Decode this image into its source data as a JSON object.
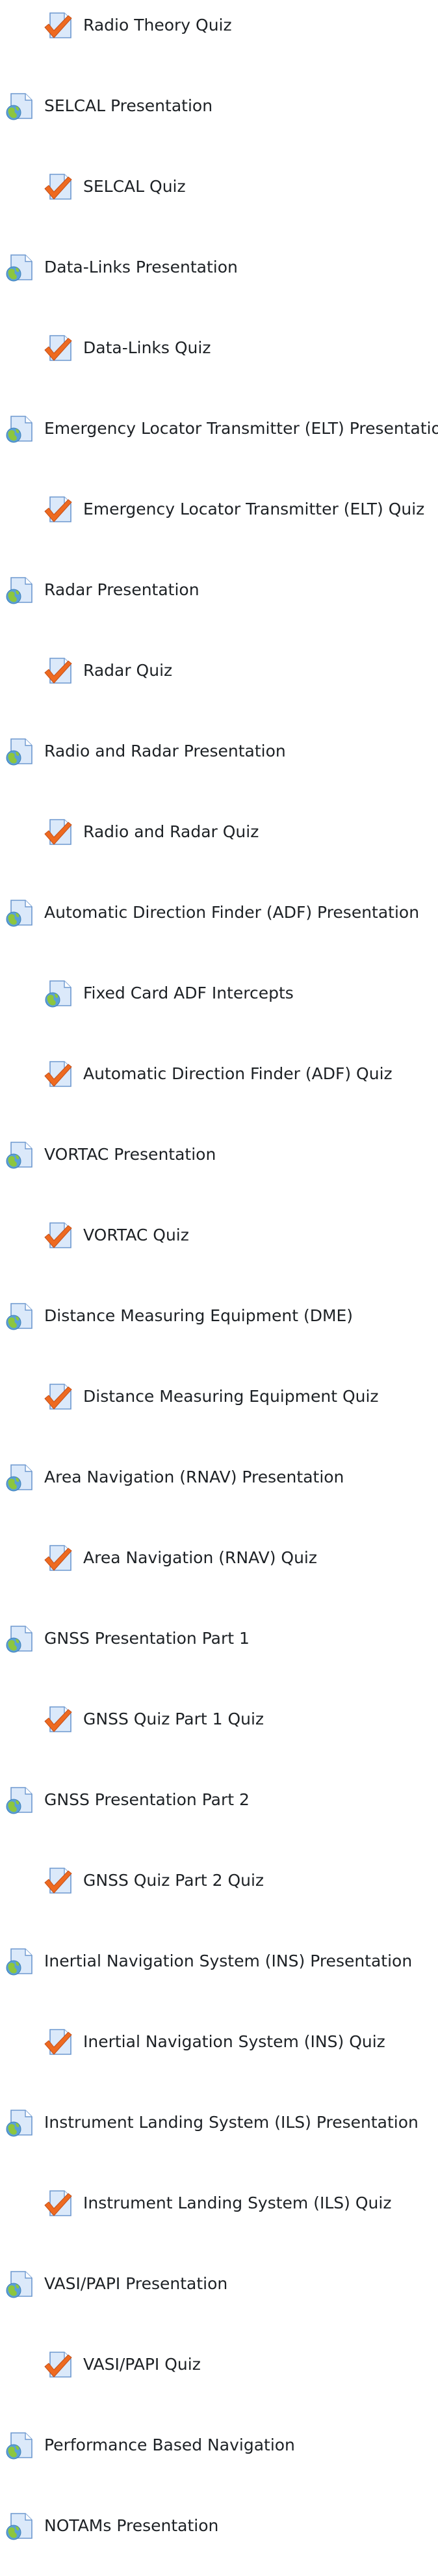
{
  "activities": [
    {
      "label": "Radio Theory Quiz",
      "type": "quiz",
      "indent": 1
    },
    {
      "label": "SELCAL Presentation",
      "type": "url",
      "indent": 0
    },
    {
      "label": "SELCAL Quiz",
      "type": "quiz",
      "indent": 1
    },
    {
      "label": "Data-Links Presentation",
      "type": "url",
      "indent": 0
    },
    {
      "label": "Data-Links Quiz",
      "type": "quiz",
      "indent": 1
    },
    {
      "label": "Emergency Locator Transmitter (ELT) Presentation",
      "type": "url",
      "indent": 0
    },
    {
      "label": "Emergency Locator Transmitter (ELT) Quiz",
      "type": "quiz",
      "indent": 1
    },
    {
      "label": "Radar Presentation",
      "type": "url",
      "indent": 0
    },
    {
      "label": "Radar Quiz",
      "type": "quiz",
      "indent": 1
    },
    {
      "label": "Radio and Radar Presentation",
      "type": "url",
      "indent": 0
    },
    {
      "label": "Radio and Radar Quiz",
      "type": "quiz",
      "indent": 1
    },
    {
      "label": "Automatic Direction Finder (ADF) Presentation",
      "type": "url",
      "indent": 0
    },
    {
      "label": "Fixed Card ADF Intercepts",
      "type": "url",
      "indent": 1
    },
    {
      "label": "Automatic Direction Finder (ADF) Quiz",
      "type": "quiz",
      "indent": 1
    },
    {
      "label": "VORTAC Presentation",
      "type": "url",
      "indent": 0
    },
    {
      "label": "VORTAC Quiz",
      "type": "quiz",
      "indent": 1
    },
    {
      "label": "Distance Measuring Equipment (DME)",
      "type": "url",
      "indent": 0
    },
    {
      "label": "Distance Measuring Equipment Quiz",
      "type": "quiz",
      "indent": 1
    },
    {
      "label": "Area Navigation (RNAV) Presentation",
      "type": "url",
      "indent": 0
    },
    {
      "label": "Area Navigation (RNAV) Quiz",
      "type": "quiz",
      "indent": 1
    },
    {
      "label": "GNSS Presentation Part 1",
      "type": "url",
      "indent": 0
    },
    {
      "label": "GNSS Quiz Part 1 Quiz",
      "type": "quiz",
      "indent": 1
    },
    {
      "label": "GNSS Presentation Part 2",
      "type": "url",
      "indent": 0
    },
    {
      "label": "GNSS Quiz Part 2 Quiz",
      "type": "quiz",
      "indent": 1
    },
    {
      "label": "Inertial Navigation System (INS) Presentation",
      "type": "url",
      "indent": 0
    },
    {
      "label": "Inertial Navigation System (INS) Quiz",
      "type": "quiz",
      "indent": 1
    },
    {
      "label": "Instrument Landing System (ILS) Presentation",
      "type": "url",
      "indent": 0
    },
    {
      "label": "Instrument Landing System (ILS) Quiz",
      "type": "quiz",
      "indent": 1
    },
    {
      "label": "VASI/PAPI Presentation",
      "type": "url",
      "indent": 0
    },
    {
      "label": "VASI/PAPI Quiz",
      "type": "quiz",
      "indent": 1
    },
    {
      "label": "Performance Based Navigation",
      "type": "url",
      "indent": 0
    },
    {
      "label": "NOTAMs Presentation",
      "type": "url",
      "indent": 0
    }
  ],
  "icons": {
    "url": "url-globe-icon",
    "quiz": "quiz-checkmark-icon"
  },
  "colors": {
    "text": "#1d2125",
    "page_fill": "#dbe9fa",
    "page_stroke": "#6d98cf",
    "globe_ocean": "#5aa0d8",
    "globe_land": "#8cc63f",
    "check": "#ee6a20",
    "check_stroke": "#c4501a"
  }
}
